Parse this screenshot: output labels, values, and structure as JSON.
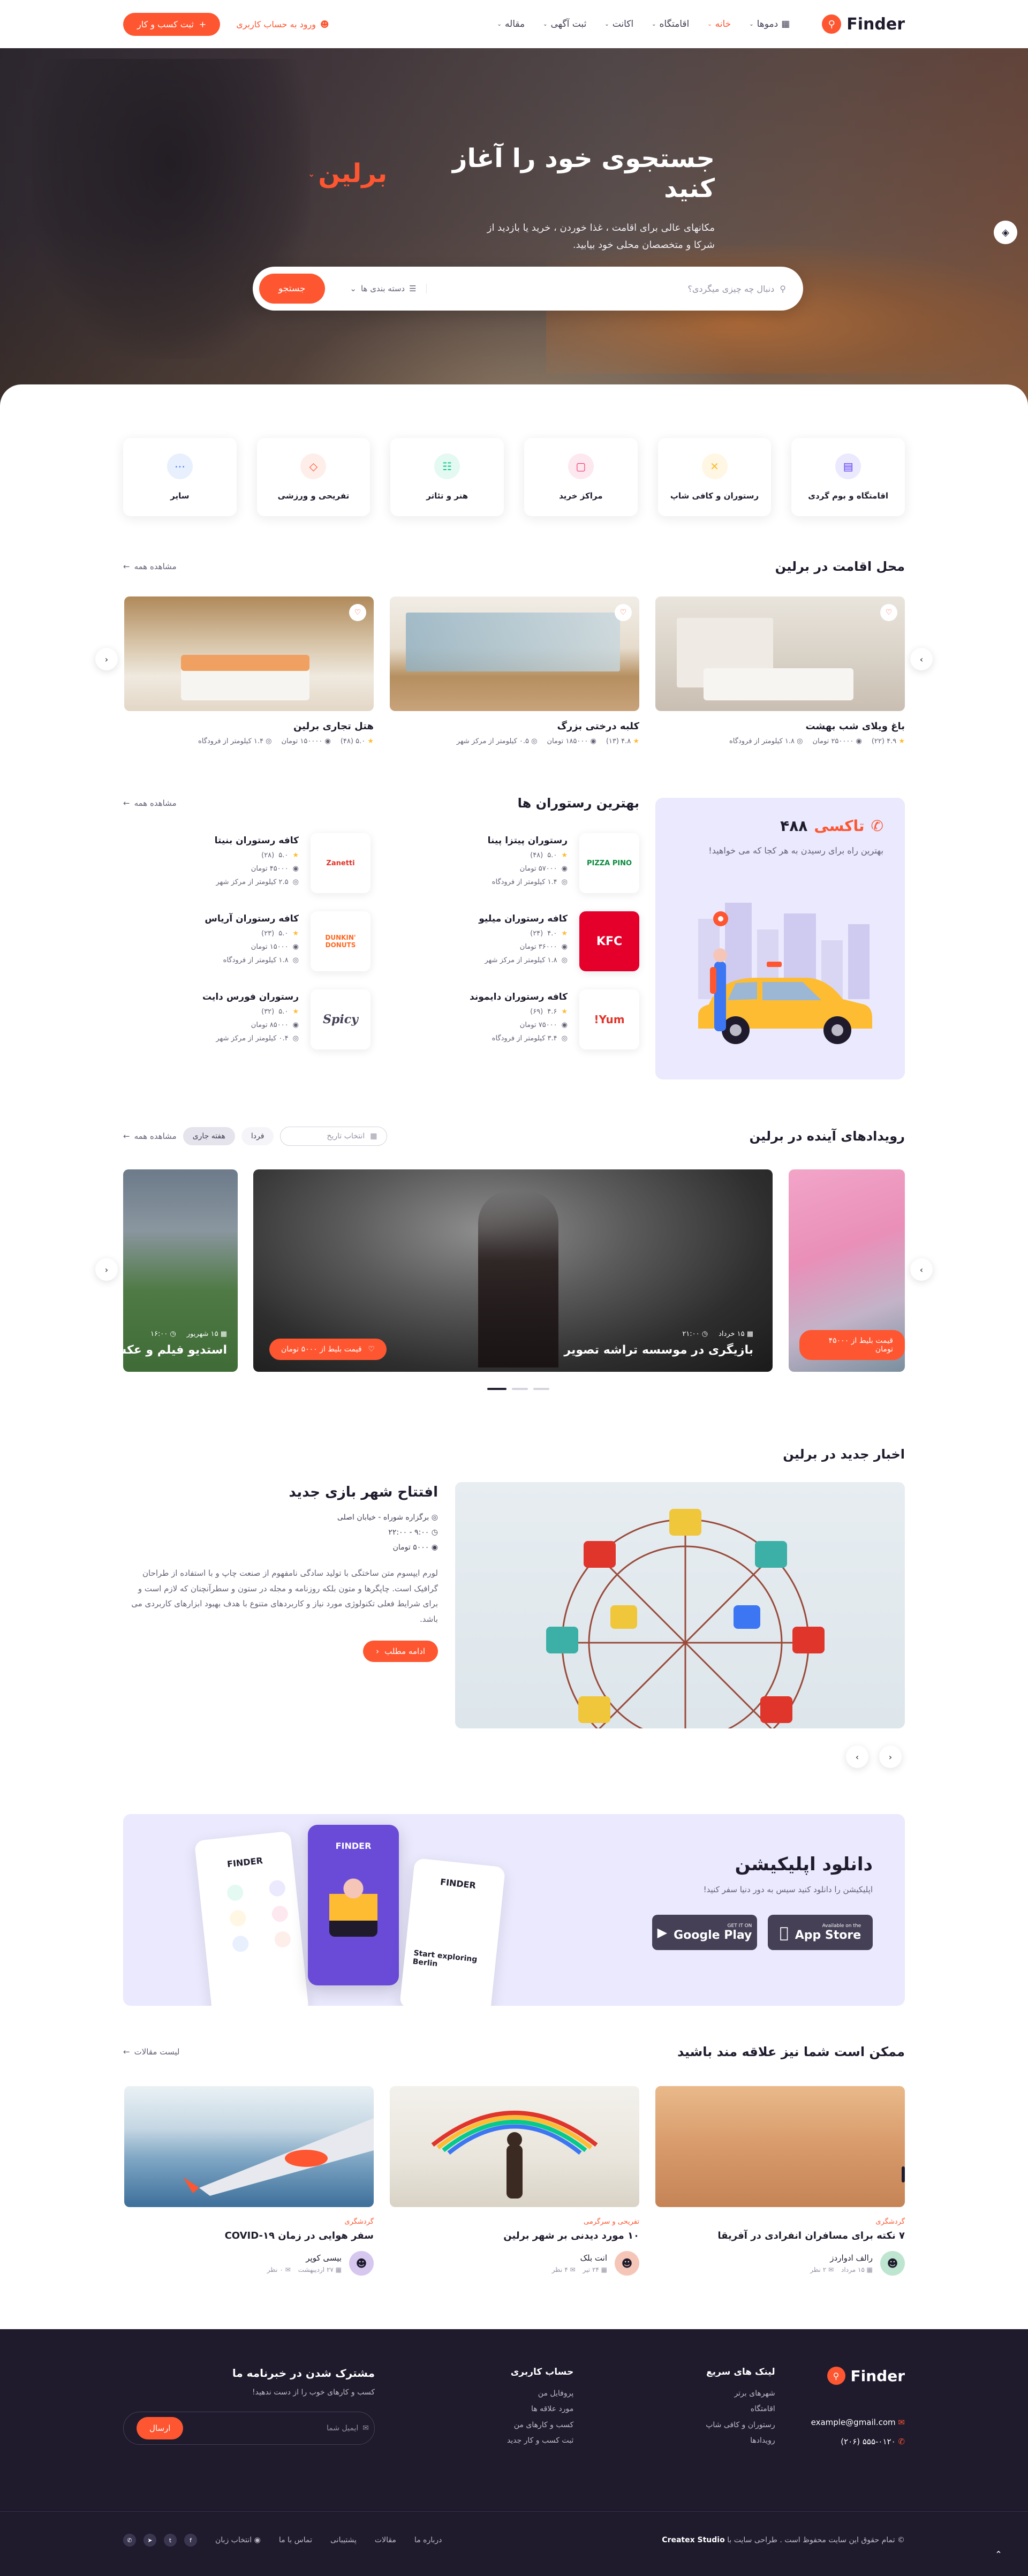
{
  "header": {
    "brand": "Finder",
    "nav": [
      {
        "label": "دموها",
        "icon": "grid-icon"
      },
      {
        "label": "خانه",
        "active": true
      },
      {
        "label": "اقامتگاه"
      },
      {
        "label": "اکانت"
      },
      {
        "label": "ثبت آگهی"
      },
      {
        "label": "مقاله"
      }
    ],
    "signin": "ورود به حساب کاربری",
    "add_business": "ثبت کسب و کار"
  },
  "hero": {
    "title": "جستجوی خود را آغاز کنید",
    "city": "برلین",
    "subtitle": "مکانهای عالی برای اقامت ، غذا خوردن ، خرید یا بازدید از شرکا و متخصصان محلی خود بیابید.",
    "search_placeholder": "دنبال چه چیزی میگردی؟",
    "category_label": "دسته بندی ها",
    "search_button": "جستجو"
  },
  "categories": [
    {
      "label": "اقامتگاه و بوم گردی",
      "icon": "bed-icon",
      "color": "#5d3cf2",
      "bg": "#eae9fd"
    },
    {
      "label": "رستوران و کافی شاپ",
      "icon": "food-icon",
      "color": "#fdbc31",
      "bg": "#fff6e3"
    },
    {
      "label": "مراکز خرید",
      "icon": "shopping-bag-icon",
      "color": "#f52f6e",
      "bg": "#fde8ef"
    },
    {
      "label": "هنر و تئاتر",
      "icon": "theater-icon",
      "color": "#07c98b",
      "bg": "#e3f9f1"
    },
    {
      "label": "تفریحی و ورزشی",
      "icon": "ticket-icon",
      "color": "#fd5631",
      "bg": "#feeeea"
    },
    {
      "label": "سایر",
      "icon": "more-icon",
      "color": "#3c76f2",
      "bg": "#e8effd"
    }
  ],
  "stays": {
    "title": "محل اقامت در برلین",
    "see_all": "مشاهده همه",
    "items": [
      {
        "name": "باغ ویلای شب بهشت",
        "rating": "۴.۹",
        "reviews": "(۲۲)",
        "price": "۲۵۰۰۰۰ تومان",
        "distance": "۱.۸ کیلومتر از فرودگاه"
      },
      {
        "name": "کلبه درختی بزرگ",
        "rating": "۴.۸",
        "reviews": "(۱۳)",
        "price": "۱۸۵۰۰۰ تومان",
        "distance": "۰.۵ کیلومتر از مرکز شهر"
      },
      {
        "name": "هتل تجاری برلین",
        "rating": "۵.۰",
        "reviews": "(۴۸)",
        "price": "۱۵۰۰۰۰ تومان",
        "distance": "۱.۴ کیلومتر از فرودگاه"
      }
    ]
  },
  "taxi": {
    "title_number": "۴۸۸",
    "title_label": "تاکسی",
    "subtitle": "بهترین راه برای رسیدن به هر کجا که می خواهید!"
  },
  "restaurants": {
    "title": "بهترین رستوران ها",
    "see_all": "مشاهده همه",
    "items": [
      {
        "name": "رستوران پیتزا پینا",
        "logo": "PIZZA PINO",
        "logo_color": "#0a8a3c",
        "rating": "۵.۰",
        "reviews": "(۴۸)",
        "price": "۵۷۰۰۰ تومان",
        "distance": "۱.۴ کیلومتر از فرودگاه"
      },
      {
        "name": "کافه رستوران بنیتا",
        "logo": "Zanetti",
        "logo_color": "#e0352b",
        "rating": "۵.۰",
        "reviews": "(۲۸)",
        "price": "۴۵۰۰۰ تومان",
        "distance": "۲.۵ کیلومتر از مرکز شهر"
      },
      {
        "name": "کافه رستوران میلیو",
        "logo": "KFC",
        "logo_color": "#e4002b",
        "rating": "۴.۰",
        "reviews": "(۲۴)",
        "price": "۳۶۰۰۰ تومان",
        "distance": "۱.۸ کیلومتر از مرکز شهر"
      },
      {
        "name": "کافه رستوران آریاس",
        "logo": "DUNKIN' DONUTS",
        "logo_color": "#ff671f",
        "rating": "۵.۰",
        "reviews": "(۲۳)",
        "price": "۱۵۰۰۰ تومان",
        "distance": "۱.۸ کیلومتر از فرودگاه"
      },
      {
        "name": "کافه رستوران دایموند",
        "logo": "Yum!",
        "logo_color": "#e0352b",
        "rating": "۴.۶",
        "reviews": "(۶۹)",
        "price": "۷۵۰۰۰ تومان",
        "distance": "۳.۴ کیلومتر از فرودگاه"
      },
      {
        "name": "رستوران فورس دایت",
        "logo": "Spicy",
        "logo_color": "#454056",
        "rating": "۵.۰",
        "reviews": "(۳۲)",
        "price": "۸۵۰۰۰ تومان",
        "distance": "۰.۴ کیلومتر از مرکز شهر"
      }
    ]
  },
  "events": {
    "title": "رویدادهای آینده در برلین",
    "see_all": "مشاهده همه",
    "filters": [
      "هفته جاری",
      "فردا"
    ],
    "date_placeholder": "انتخاب تاریخ",
    "main": {
      "date": "۱۵ خرداد",
      "time": "۲۱:۰۰",
      "title": "بازیگری در موسسه تراشه تصویر",
      "price": "قیمت بلیط از ۵۰۰۰ تومان"
    },
    "left": {
      "date": "۱۵ شهریور",
      "time": "۱۶:۰۰",
      "title": "استدیو فیلم و عکس"
    },
    "right": {
      "price": "قیمت بلیط از ۴۵۰۰۰ تومان"
    }
  },
  "news": {
    "title": "اخبار جدید در برلین",
    "headline": "افتتاح شهر بازی جدید",
    "location": "برگزاره شوراه - خیابان اصلی",
    "time": "۹:۰۰ - ۲۲:۰۰",
    "price": "۵۰۰۰ تومان",
    "body": "لورم ایپسوم متن ساختگی با تولید سادگی نامفهوم از صنعت چاپ و با استفاده از طراحان گرافیک است. چاپگرها و متون بلکه روزنامه و مجله در ستون و سطرآنچنان که لازم است و برای شرایط فعلی تکنولوژی مورد نیاز و کاربردهای متنوع با هدف بهبود ابزارهای کاربردی می باشد.",
    "read_more": "ادامه مطلب"
  },
  "app": {
    "title": "دانلود اپلیکیشن",
    "subtitle": "اپلیکیشن را دانلود کنید سیس به دور دنیا سفر کنید!",
    "google_small": "GET IT ON",
    "google_big": "Google Play",
    "apple_small": "Available on the",
    "apple_big": "App Store",
    "phone_title": "FINDER",
    "card_text": "Start exploring Berlin"
  },
  "blog": {
    "title": "ممکن است شما نیز علاقه مند باشید",
    "see_all": "لیست مقالات",
    "items": [
      {
        "category": "گردشگری",
        "title": "۷ نکته برای مسافران انفرادی در آفریقا",
        "author": "رالف ادواردز",
        "date": "۱۵ مرداد",
        "comments": "۲ نظر"
      },
      {
        "category": "تفریحی و سرگرمی",
        "title": "۱۰ مورد دیدنی بر شهر برلین",
        "author": "انت بلک",
        "date": "۲۴ تیر",
        "comments": "۴ نظر"
      },
      {
        "category": "گردشگری",
        "title": "سفر هوایی در زمان COVID-۱۹",
        "author": "بیسی کوپر",
        "date": "۲۷ اردیبهشت",
        "comments": "۰ نظر"
      }
    ]
  },
  "footer": {
    "brand": "Finder",
    "email": "example@gmail.com",
    "phone": "(۲۰۶) ۵۵۵-۰۱۲۰",
    "quick_links_title": "لینک های سریع",
    "quick_links": [
      "شهرهای برتر",
      "اقامتگاه",
      "رستوران و کافی شاپ",
      "رویدادها"
    ],
    "account_title": "حساب کاربری",
    "account_links": [
      "پروفایل من",
      "مورد علاقه ها",
      "کسب و کارهای من",
      "ثبت کسب و کار جدید"
    ],
    "newsletter_title": "مشترک شدن در خبرنامه ما",
    "newsletter_sub": "کسب و کارهای خوب را از دست ندهید!",
    "email_placeholder": "ایمیل شما",
    "send": "ارسال",
    "copyright": "© تمام حقوق این سایت محفوظ است . طراحی سایت با",
    "copyright_brand": "Createx Studio",
    "bottom_links": [
      "درباره ما",
      "مقالات",
      "پشتیبانی",
      "تماس با ما"
    ],
    "language": "انتخاب زبان"
  }
}
